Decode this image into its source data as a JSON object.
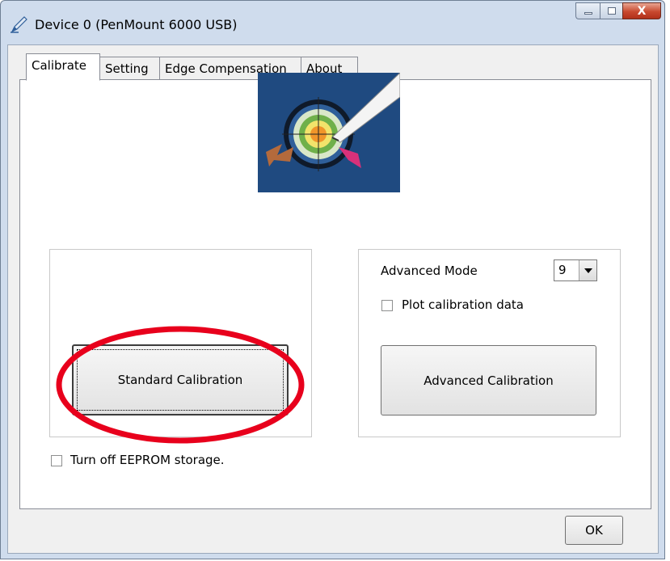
{
  "window": {
    "title": "Device 0 (PenMount 6000 USB)",
    "close_glyph": "X"
  },
  "tabs": [
    {
      "label": "Calibrate",
      "active": true
    },
    {
      "label": "Setting",
      "active": false
    },
    {
      "label": "Edge Compensation",
      "active": false
    },
    {
      "label": "About",
      "active": false
    }
  ],
  "calibrate": {
    "standard_button": "Standard Calibration",
    "advanced_mode_label": "Advanced Mode",
    "advanced_mode_value": "9",
    "plot_label": "Plot calibration data",
    "advanced_button": "Advanced Calibration",
    "eeprom_label": "Turn off EEPROM storage."
  },
  "footer": {
    "ok_label": "OK"
  },
  "colors": {
    "highlight": "#e8001c",
    "image_background": "#1f4a80"
  }
}
